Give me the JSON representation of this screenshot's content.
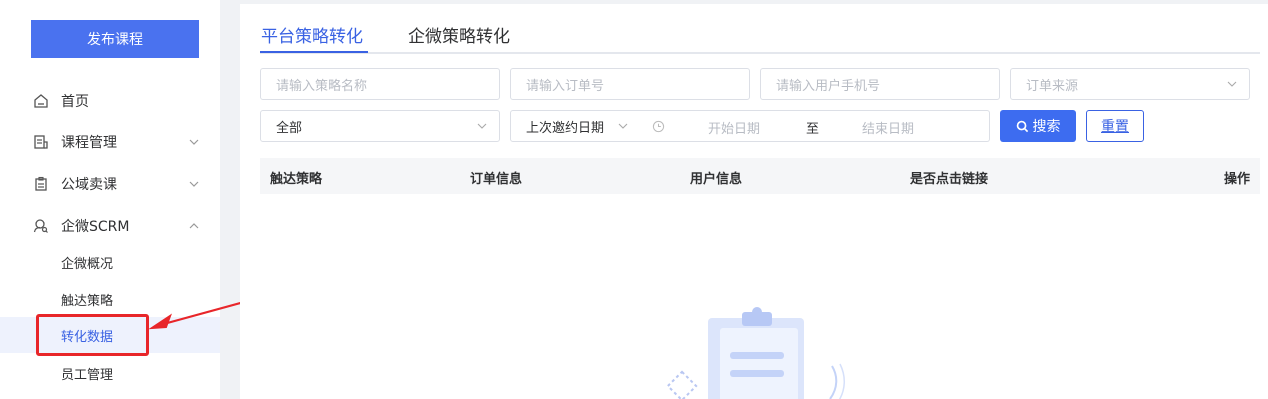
{
  "sidebar": {
    "publish_label": "发布课程",
    "items": [
      {
        "label": "首页",
        "icon": "home-icon"
      },
      {
        "label": "课程管理",
        "icon": "course-icon"
      },
      {
        "label": "公域卖课",
        "icon": "clipboard-icon"
      },
      {
        "label": "企微SCRM",
        "icon": "user-search-icon"
      }
    ],
    "sub_items": [
      {
        "label": "企微概况"
      },
      {
        "label": "触达策略"
      },
      {
        "label": "转化数据"
      },
      {
        "label": "员工管理"
      }
    ],
    "active_sub": "转化数据"
  },
  "tabs": [
    {
      "label": "平台策略转化"
    },
    {
      "label": "企微策略转化"
    }
  ],
  "filters": {
    "strategy_placeholder": "请输入策略名称",
    "order_placeholder": "请输入订单号",
    "phone_placeholder": "请输入用户手机号",
    "source_placeholder": "订单来源",
    "scope_value": "全部",
    "date_type_value": "上次邀约日期",
    "start_placeholder": "开始日期",
    "range_separator": "至",
    "end_placeholder": "结束日期",
    "search_label": "搜索",
    "reset_label": "重置"
  },
  "table": {
    "columns": [
      "触达策略",
      "订单信息",
      "用户信息",
      "是否点击链接",
      "操作"
    ]
  },
  "colors": {
    "accent": "#3a62e3",
    "primary_button": "#4a72ef",
    "highlight_red": "#e8262a"
  }
}
